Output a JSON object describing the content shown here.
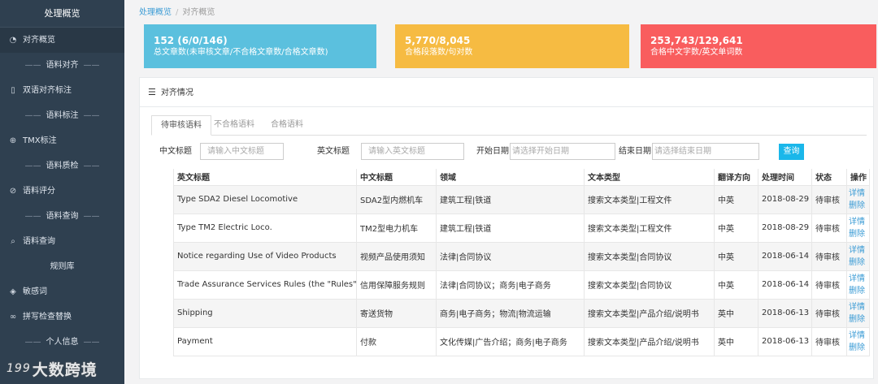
{
  "sidebar": {
    "title": "处理概览",
    "items": [
      {
        "type": "item",
        "icon": "dashboard-icon",
        "glyph": "◔",
        "label": "对齐概览",
        "active": true
      },
      {
        "type": "section",
        "label": "语料对齐"
      },
      {
        "type": "item",
        "icon": "file-icon",
        "glyph": "▯",
        "label": "双语对齐标注"
      },
      {
        "type": "section",
        "label": "语料标注"
      },
      {
        "type": "item",
        "icon": "plus-circle-icon",
        "glyph": "⊕",
        "label": "TMX标注"
      },
      {
        "type": "section",
        "label": "语料质检"
      },
      {
        "type": "item",
        "icon": "check-circle-icon",
        "glyph": "⊘",
        "label": "语料评分"
      },
      {
        "type": "section",
        "label": "语料查询"
      },
      {
        "type": "item",
        "icon": "search-icon",
        "glyph": "⌕",
        "label": "语料查询"
      },
      {
        "type": "plain",
        "label": "规则库"
      },
      {
        "type": "item",
        "icon": "shield-icon",
        "glyph": "◈",
        "label": "敏感词"
      },
      {
        "type": "item",
        "icon": "glasses-icon",
        "glyph": "∞",
        "label": "拼写检查替换"
      },
      {
        "type": "section",
        "label": "个人信息"
      }
    ],
    "dash": "——"
  },
  "watermark": {
    "mark": "199",
    "text": "大数跨境"
  },
  "breadcrumb": {
    "root": "处理概览",
    "current": "对齐概览",
    "separator": "/"
  },
  "stats": [
    {
      "value": "152 (6/0/146)",
      "desc": "总文章数(未审核文章/不合格文章数/合格文章数)",
      "color": "#5bc0de"
    },
    {
      "value": "5,770/8,045",
      "desc": "合格段落数/句对数",
      "color": "#f6bb42"
    },
    {
      "value": "253,743/129,641",
      "desc": "合格中文字数/英文单词数",
      "color": "#f95d5e"
    }
  ],
  "panel": {
    "title": "对齐情况",
    "icon": "list-icon"
  },
  "tabs": [
    {
      "label": "待审核语料",
      "active": true
    },
    {
      "label": "不合格语料",
      "active": false
    },
    {
      "label": "合格语料",
      "active": false
    }
  ],
  "filters": {
    "cn_title_label": "中文标题",
    "cn_title_placeholder": "请输入中文标题",
    "en_title_label": "英文标题",
    "en_title_placeholder": "请输入英文标题",
    "start_label": "开始日期",
    "start_placeholder": "请选择开始日期",
    "end_label": "结束日期",
    "end_placeholder": "请选择结束日期",
    "query_label": "查询"
  },
  "table": {
    "headers": [
      "英文标题",
      "中文标题",
      "领域",
      "文本类型",
      "翻译方向",
      "处理时间",
      "状态",
      "操作"
    ],
    "detail_label": "详情",
    "delete_label": "删除",
    "rows": [
      {
        "en": "Type SDA2 Diesel Locomotive",
        "cn": "SDA2型内燃机车",
        "domain": "建筑工程|铁道",
        "type": "搜索文本类型|工程文件",
        "dir": "中英",
        "time": "2018-08-29",
        "status": "待审核"
      },
      {
        "en": "Type TM2 Electric Loco.",
        "cn": "TM2型电力机车",
        "domain": "建筑工程|铁道",
        "type": "搜索文本类型|工程文件",
        "dir": "中英",
        "time": "2018-08-29",
        "status": "待审核"
      },
      {
        "en": "Notice regarding Use of Video Products",
        "cn": "视频产品使用须知",
        "domain": "法律|合同协议",
        "type": "搜索文本类型|合同协议",
        "dir": "中英",
        "time": "2018-06-14",
        "status": "待审核"
      },
      {
        "en": "Trade Assurance Services Rules (the \"Rules\")",
        "cn": "信用保障服务规则",
        "domain": "法律|合同协议；商务|电子商务",
        "type": "搜索文本类型|合同协议",
        "dir": "中英",
        "time": "2018-06-14",
        "status": "待审核"
      },
      {
        "en": "Shipping",
        "cn": "寄送货物",
        "domain": "商务|电子商务；物流|物流运输",
        "type": "搜索文本类型|产品介绍/说明书",
        "dir": "英中",
        "time": "2018-06-13",
        "status": "待审核"
      },
      {
        "en": "Payment",
        "cn": "付款",
        "domain": "文化传媒|广告介绍；商务|电子商务",
        "type": "搜索文本类型|产品介绍/说明书",
        "dir": "英中",
        "time": "2018-06-13",
        "status": "待审核"
      }
    ]
  }
}
